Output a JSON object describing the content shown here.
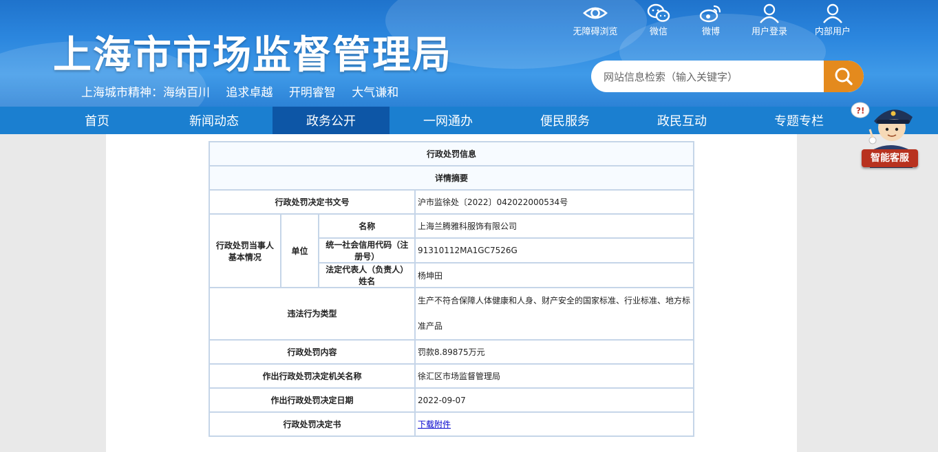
{
  "header": {
    "title": "上海市市场监督管理局",
    "motto": [
      "上海城市精神：海纳百川",
      "追求卓越",
      "开明睿智",
      "大气谦和"
    ],
    "quick_links": [
      {
        "label": "无障碍浏览",
        "icon": "eye-icon"
      },
      {
        "label": "微信",
        "icon": "wechat-icon"
      },
      {
        "label": "微博",
        "icon": "weibo-icon"
      },
      {
        "label": "用户登录",
        "icon": "user-icon"
      },
      {
        "label": "内部用户",
        "icon": "user-icon"
      }
    ],
    "search": {
      "placeholder": "网站信息检索（输入关键字）",
      "button_icon": "search-icon"
    }
  },
  "nav": {
    "items": [
      "首页",
      "新闻动态",
      "政务公开",
      "一网通办",
      "便民服务",
      "政民互动",
      "专题专栏"
    ],
    "active": "政务公开"
  },
  "service": {
    "label": "智能客服"
  },
  "table": {
    "title": "行政处罚信息",
    "subtitle": "详情摘要",
    "doc_no_label": "行政处罚决定书文号",
    "doc_no": "沪市监徐处〔2022〕042022000534号",
    "party_label": "行政处罚当事人基本情况",
    "unit_label": "单位",
    "name_label": "名称",
    "name": "上海兰腾雅科服饰有限公司",
    "credit_code_label": "统一社会信用代码（注册号）",
    "credit_code": "91310112MA1GC7526G",
    "legal_rep_label": "法定代表人（负责人）姓名",
    "legal_rep": "杨坤田",
    "violation_type_label": "违法行为类型",
    "violation_type": "生产不符合保障人体健康和人身、财产安全的国家标准、行业标准、地方标准产品",
    "content_label": "行政处罚内容",
    "content": "罚款8.89875万元",
    "authority_label": "作出行政处罚决定机关名称",
    "authority": "徐汇区市场监督管理局",
    "date_label": "作出行政处罚决定日期",
    "date": "2022-09-07",
    "decision_label": "行政处罚决定书",
    "decision_link": "下载附件"
  }
}
